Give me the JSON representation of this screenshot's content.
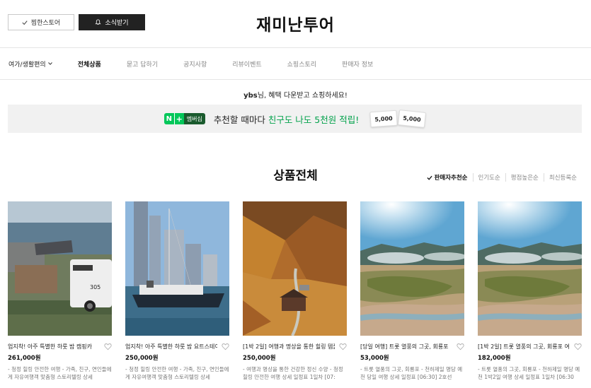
{
  "header": {
    "pick_store_label": "찜한스토어",
    "news_label": "소식받기",
    "store_name": "재미난투어"
  },
  "nav": {
    "items": [
      {
        "label": "여가/생활편의",
        "style": "strong"
      },
      {
        "label": "전체상품",
        "style": "active"
      },
      {
        "label": "묻고 답하기",
        "style": ""
      },
      {
        "label": "공지사항",
        "style": ""
      },
      {
        "label": "리뷰이벤트",
        "style": ""
      },
      {
        "label": "쇼핑스토리",
        "style": ""
      },
      {
        "label": "판매자 정보",
        "style": ""
      }
    ]
  },
  "greeting": {
    "user": "ybs",
    "message": "님, 혜택 다운받고 쇼핑하세요!"
  },
  "banner": {
    "badge_n": "N",
    "badge_plus": "+",
    "badge_member": "멤버십",
    "text_prefix": "추천할 때마다 ",
    "text_highlight": "친구도 나도 5천원 적립!",
    "coupon1": "5,000",
    "coupon2": "5,000"
  },
  "products_section": {
    "title": "상품전체",
    "sort_options": [
      "판매자추천순",
      "인기도순",
      "평점높은순",
      "최신등록순"
    ]
  },
  "products": [
    {
      "title": "업지착! 아주 특별한 하룻 밤 캠핑카",
      "price": "261,000원",
      "desc": "- 청정 힐링 안전한 여행 - 가족, 친구, 연인들에게 자유여행객 맞춤형 스토리텔링 상세"
    },
    {
      "title": "업지착! 아주 특별한 하룻 밤 요트스테이",
      "price": "250,000원",
      "desc": "- 청정 힐링 안전한 여행 - 가족, 친구, 연인들에게 자유여행객 맞춤형 스토리텔링 상세"
    },
    {
      "title": "[1박 2일] 여행과 명상을 통한 힐링 템플스테이",
      "price": "250,000원",
      "desc": "- 여행과 명상을 통한 건강한 정신 수양 - 청정 힐링 안전한 여행 상세 일정표 1일차 [07:"
    },
    {
      "title": "[당일 여행] 트롯 열풍의 그곳, 회룡포",
      "price": "53,000원",
      "desc": "- 트롯 열풍의 그곳, 회룡포 - 천하제일 명당 예천 당일 여행 상세 일정표 [06:30] 2호선"
    },
    {
      "title": "[1박 2일] 트롯 열풍의 그곳, 회룡포 여행",
      "price": "182,000원",
      "desc": "- 트롯 열풍의 그곳, 회룡포 - 천하제일 명당 예천 1박2일 여행 상세 일정표 1일차 [06:30"
    }
  ]
}
